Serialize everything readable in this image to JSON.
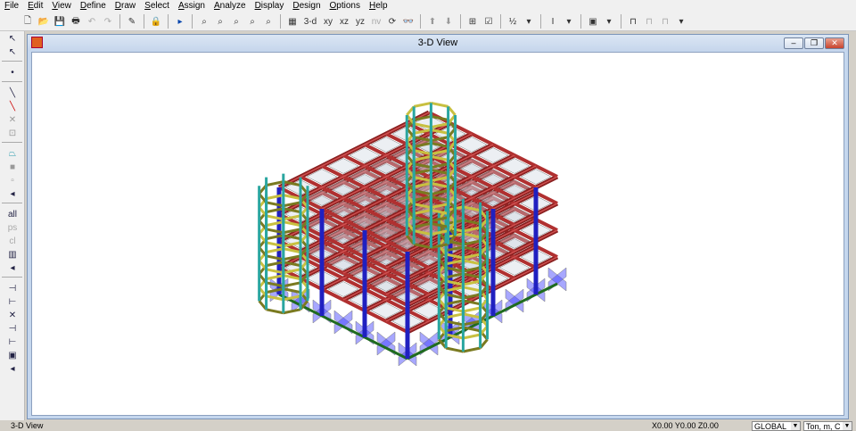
{
  "menu": [
    "File",
    "Edit",
    "View",
    "Define",
    "Draw",
    "Select",
    "Assign",
    "Analyze",
    "Display",
    "Design",
    "Options",
    "Help"
  ],
  "toolbar": {
    "view_3d": "3-d",
    "view_xy": "xy",
    "view_xz": "xz",
    "view_yz": "yz",
    "view_nv": "nv"
  },
  "window": {
    "title": "3-D View",
    "minimize": "‒",
    "restore": "❐",
    "close": "✕"
  },
  "status": {
    "left": "3-D View",
    "coords": "X0.00  Y0.00  Z0.00",
    "coord_system": "GLOBAL",
    "units": "Ton, m, C"
  }
}
